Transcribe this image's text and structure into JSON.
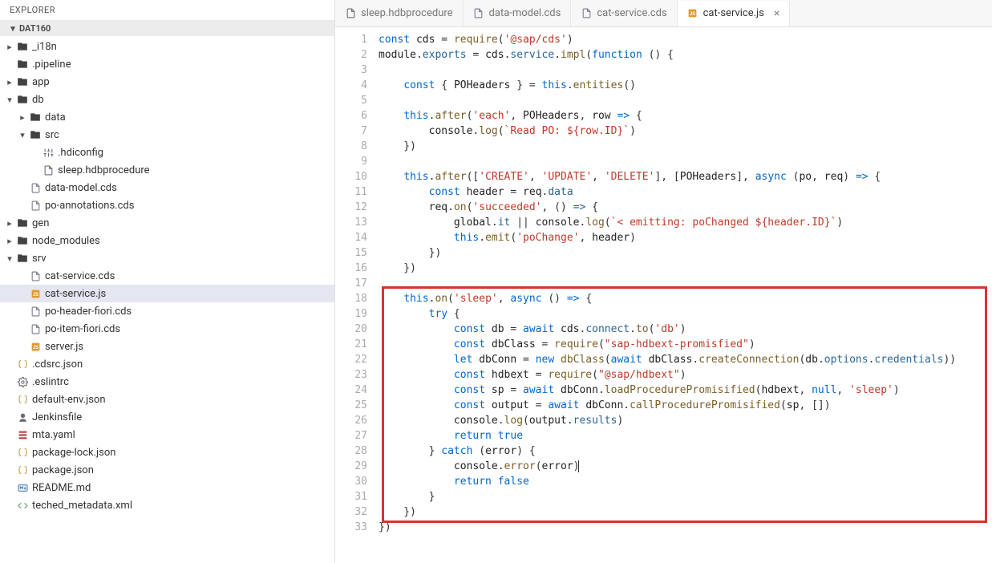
{
  "sidebar": {
    "title": "EXPLORER",
    "section": "DAT160",
    "nodes": [
      {
        "indent": 0,
        "chev": "right",
        "icon": "folder",
        "color": "ic-folder",
        "label": "_i18n"
      },
      {
        "indent": 0,
        "chev": "",
        "icon": "folder",
        "color": "ic-folder",
        "label": ".pipeline"
      },
      {
        "indent": 0,
        "chev": "right",
        "icon": "folder",
        "color": "ic-folder",
        "label": "app"
      },
      {
        "indent": 0,
        "chev": "down",
        "icon": "folder",
        "color": "ic-folder",
        "label": "db"
      },
      {
        "indent": 1,
        "chev": "right",
        "icon": "folder",
        "color": "ic-folder",
        "label": "data"
      },
      {
        "indent": 1,
        "chev": "down",
        "icon": "folder",
        "color": "ic-folder",
        "label": "src"
      },
      {
        "indent": 2,
        "chev": "",
        "icon": "sliders",
        "color": "ic-file",
        "label": ".hdiconfig"
      },
      {
        "indent": 2,
        "chev": "",
        "icon": "file",
        "color": "ic-file",
        "label": "sleep.hdbprocedure"
      },
      {
        "indent": 1,
        "chev": "",
        "icon": "file",
        "color": "ic-cds",
        "label": "data-model.cds"
      },
      {
        "indent": 1,
        "chev": "",
        "icon": "file",
        "color": "ic-cds",
        "label": "po-annotations.cds"
      },
      {
        "indent": 0,
        "chev": "right",
        "icon": "folder",
        "color": "ic-folder",
        "label": "gen"
      },
      {
        "indent": 0,
        "chev": "right",
        "icon": "folder",
        "color": "ic-folder",
        "label": "node_modules"
      },
      {
        "indent": 0,
        "chev": "down",
        "icon": "folder",
        "color": "ic-folder",
        "label": "srv"
      },
      {
        "indent": 1,
        "chev": "",
        "icon": "file",
        "color": "ic-cds",
        "label": "cat-service.cds"
      },
      {
        "indent": 1,
        "chev": "",
        "icon": "js",
        "color": "ic-js",
        "label": "cat-service.js",
        "active": true
      },
      {
        "indent": 1,
        "chev": "",
        "icon": "file",
        "color": "ic-cds",
        "label": "po-header-fiori.cds"
      },
      {
        "indent": 1,
        "chev": "",
        "icon": "file",
        "color": "ic-cds",
        "label": "po-item-fiori.cds"
      },
      {
        "indent": 1,
        "chev": "",
        "icon": "js",
        "color": "ic-js",
        "label": "server.js"
      },
      {
        "indent": 0,
        "chev": "",
        "icon": "json",
        "color": "ic-json",
        "label": ".cdsrc.json"
      },
      {
        "indent": 0,
        "chev": "",
        "icon": "gear",
        "color": "ic-file",
        "label": ".eslintrc"
      },
      {
        "indent": 0,
        "chev": "",
        "icon": "json",
        "color": "ic-json",
        "label": "default-env.json"
      },
      {
        "indent": 0,
        "chev": "",
        "icon": "jenkins",
        "color": "ic-file",
        "label": "Jenkinsfile"
      },
      {
        "indent": 0,
        "chev": "",
        "icon": "yaml",
        "color": "ic-yaml",
        "label": "mta.yaml"
      },
      {
        "indent": 0,
        "chev": "",
        "icon": "json",
        "color": "ic-json",
        "label": "package-lock.json"
      },
      {
        "indent": 0,
        "chev": "",
        "icon": "json",
        "color": "ic-json",
        "label": "package.json"
      },
      {
        "indent": 0,
        "chev": "",
        "icon": "md",
        "color": "ic-md",
        "label": "README.md"
      },
      {
        "indent": 0,
        "chev": "",
        "icon": "xml",
        "color": "ic-xml",
        "label": "teched_metadata.xml"
      }
    ]
  },
  "tabs": [
    {
      "icon": "file",
      "color": "ic-file",
      "label": "sleep.hdbprocedure",
      "active": false,
      "closable": false
    },
    {
      "icon": "file",
      "color": "ic-cds",
      "label": "data-model.cds",
      "active": false,
      "closable": false
    },
    {
      "icon": "file",
      "color": "ic-cds",
      "label": "cat-service.cds",
      "active": false,
      "closable": false
    },
    {
      "icon": "js",
      "color": "ic-js",
      "label": "cat-service.js",
      "active": true,
      "closable": true
    }
  ],
  "editor": {
    "highlight_start_line": 18,
    "highlight_end_line": 32,
    "lines": [
      {
        "n": 1,
        "html": "<span class='kw'>const</span> <span class='id'>cds</span> = <span class='fn'>require</span>(<span class='str'>'@sap/cds'</span>)"
      },
      {
        "n": 2,
        "html": "<span class='id'>module</span>.<span class='prop'>exports</span> = <span class='id'>cds</span>.<span class='prop'>service</span>.<span class='fn'>impl</span>(<span class='kw'>function</span> () {"
      },
      {
        "n": 3,
        "html": ""
      },
      {
        "n": 4,
        "html": "    <span class='kw'>const</span> { <span class='id'>POHeaders</span> } = <span class='kw'>this</span>.<span class='fn'>entities</span>()"
      },
      {
        "n": 5,
        "html": ""
      },
      {
        "n": 6,
        "html": "    <span class='kw'>this</span>.<span class='fn'>after</span>(<span class='str'>'each'</span>, <span class='id'>POHeaders</span>, <span class='id'>row</span> <span class='kw'>=&gt;</span> {"
      },
      {
        "n": 7,
        "html": "        <span class='id'>console</span>.<span class='fn'>log</span>(<span class='tmpl'>`Read PO: ${row.ID}`</span>)"
      },
      {
        "n": 8,
        "html": "    })"
      },
      {
        "n": 9,
        "html": ""
      },
      {
        "n": 10,
        "html": "    <span class='kw'>this</span>.<span class='fn'>after</span>([<span class='str'>'CREATE'</span>, <span class='str'>'UPDATE'</span>, <span class='str'>'DELETE'</span>], [<span class='id'>POHeaders</span>], <span class='kw'>async</span> (<span class='id'>po</span>, <span class='id'>req</span>) <span class='kw'>=&gt;</span> {"
      },
      {
        "n": 11,
        "html": "        <span class='kw'>const</span> <span class='id'>header</span> = <span class='id'>req</span>.<span class='prop'>data</span>"
      },
      {
        "n": 12,
        "html": "        <span class='id'>req</span>.<span class='fn'>on</span>(<span class='str'>'succeeded'</span>, () <span class='kw'>=&gt;</span> {"
      },
      {
        "n": 13,
        "html": "            <span class='id'>global</span>.<span class='prop'>it</span> || <span class='id'>console</span>.<span class='fn'>log</span>(<span class='tmpl'>`&lt; emitting: poChanged ${header.ID}`</span>)"
      },
      {
        "n": 14,
        "html": "            <span class='kw'>this</span>.<span class='fn'>emit</span>(<span class='str'>'poChange'</span>, <span class='id'>header</span>)"
      },
      {
        "n": 15,
        "html": "        })"
      },
      {
        "n": 16,
        "html": "    })"
      },
      {
        "n": 17,
        "html": ""
      },
      {
        "n": 18,
        "html": "    <span class='kw'>this</span>.<span class='fn'>on</span>(<span class='str'>'sleep'</span>, <span class='kw'>async</span> () <span class='kw'>=&gt;</span> {"
      },
      {
        "n": 19,
        "html": "        <span class='kw'>try</span> {"
      },
      {
        "n": 20,
        "html": "            <span class='kw'>const</span> <span class='id'>db</span> = <span class='kw'>await</span> <span class='id'>cds</span>.<span class='prop'>connect</span>.<span class='fn'>to</span>(<span class='str'>'db'</span>)"
      },
      {
        "n": 21,
        "html": "            <span class='kw'>const</span> <span class='id'>dbClass</span> = <span class='fn'>require</span>(<span class='str'>\"sap-hdbext-promisfied\"</span>)"
      },
      {
        "n": 22,
        "html": "            <span class='kw'>let</span> <span class='id'>dbConn</span> = <span class='kw'>new</span> <span class='fn'>dbClass</span>(<span class='kw'>await</span> <span class='id'>dbClass</span>.<span class='fn'>createConnection</span>(<span class='id'>db</span>.<span class='prop'>options</span>.<span class='prop'>credentials</span>))"
      },
      {
        "n": 23,
        "html": "            <span class='kw'>const</span> <span class='id'>hdbext</span> = <span class='fn'>require</span>(<span class='str'>\"@sap/hdbext\"</span>)"
      },
      {
        "n": 24,
        "html": "            <span class='kw'>const</span> <span class='id'>sp</span> = <span class='kw'>await</span> <span class='id'>dbConn</span>.<span class='fn'>loadProcedurePromisified</span>(<span class='id'>hdbext</span>, <span class='kw'>null</span>, <span class='str'>'sleep'</span>)"
      },
      {
        "n": 25,
        "html": "            <span class='kw'>const</span> <span class='id'>output</span> = <span class='kw'>await</span> <span class='id'>dbConn</span>.<span class='fn'>callProcedurePromisified</span>(<span class='id'>sp</span>, [])"
      },
      {
        "n": 26,
        "html": "            <span class='id'>console</span>.<span class='fn'>log</span>(<span class='id'>output</span>.<span class='prop'>results</span>)"
      },
      {
        "n": 27,
        "html": "            <span class='kw'>return</span> <span class='kw'>true</span>"
      },
      {
        "n": 28,
        "html": "        } <span class='kw'>catch</span> (<span class='id'>error</span>) {"
      },
      {
        "n": 29,
        "html": "            <span class='id'>console</span>.<span class='fn'>error</span>(<span class='id'>error</span>)<span class='cursor'></span>"
      },
      {
        "n": 30,
        "html": "            <span class='kw'>return</span> <span class='kw'>false</span>"
      },
      {
        "n": 31,
        "html": "        }"
      },
      {
        "n": 32,
        "html": "    })"
      },
      {
        "n": 33,
        "html": "})"
      }
    ]
  }
}
